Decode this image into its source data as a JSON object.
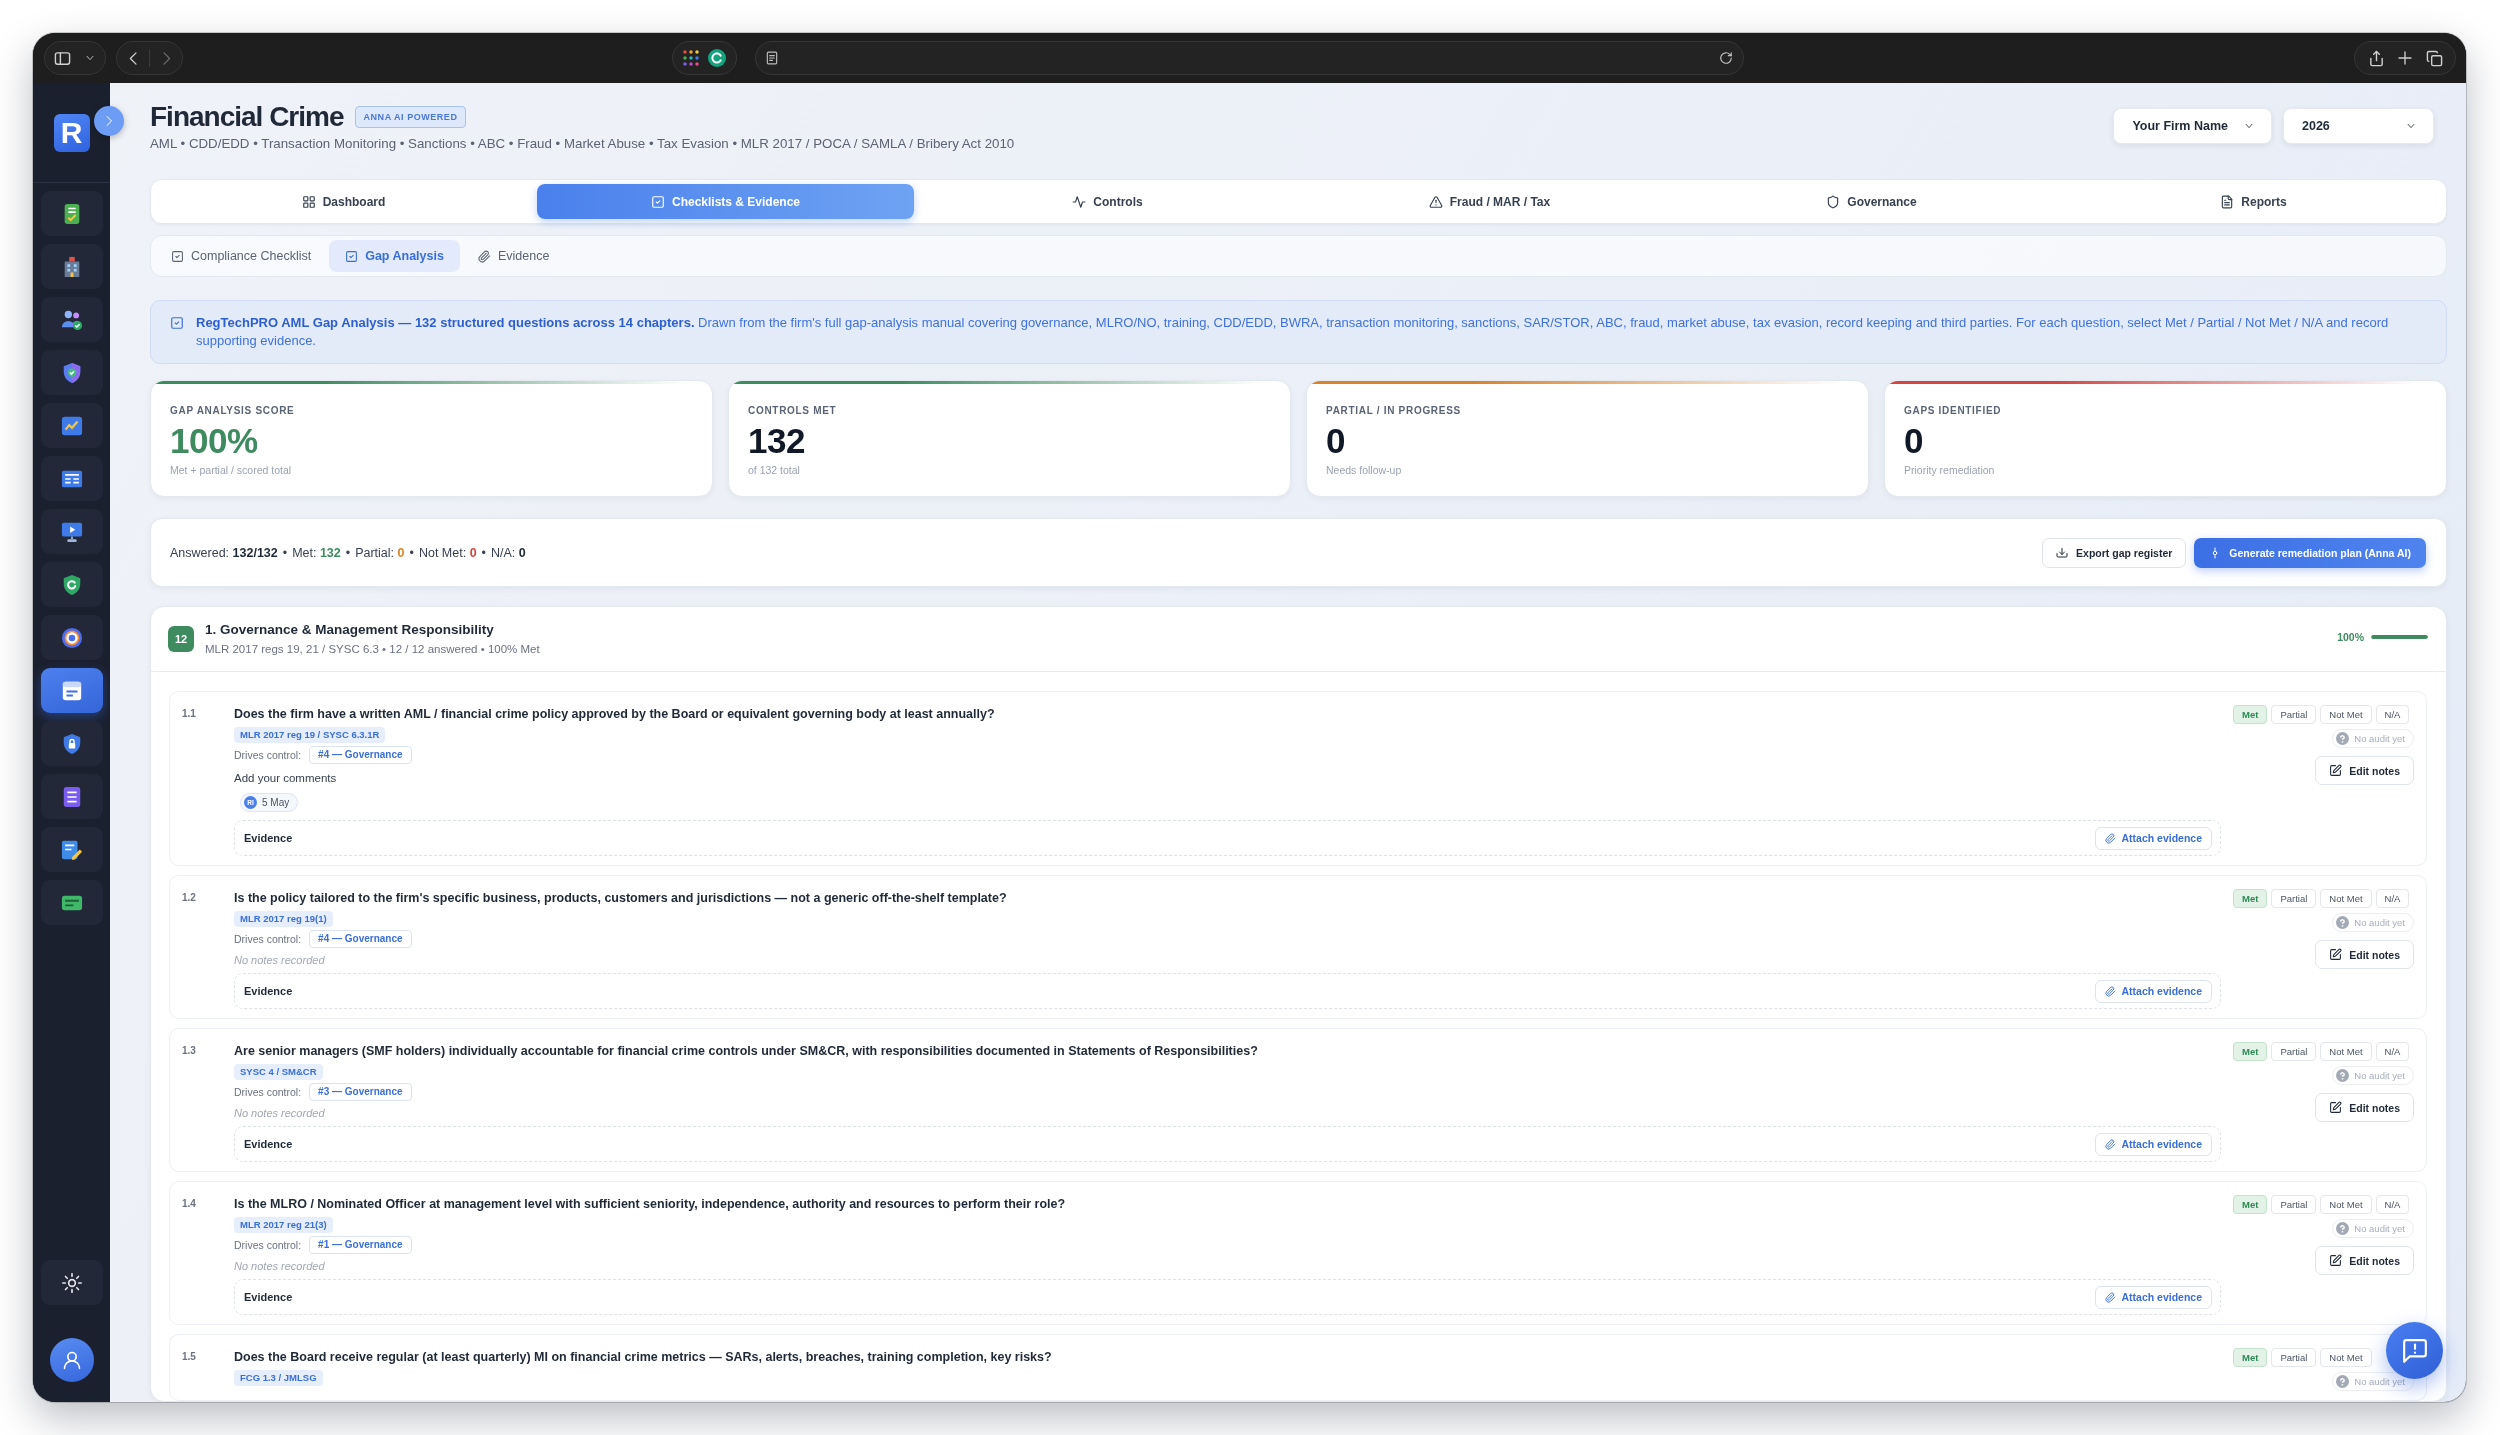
{
  "sidebar": {
    "logo": "R",
    "items": [
      {
        "selected": false
      },
      {
        "selected": false
      },
      {
        "selected": false
      },
      {
        "selected": false
      },
      {
        "selected": false
      },
      {
        "selected": false
      },
      {
        "selected": false
      },
      {
        "selected": false
      },
      {
        "selected": false
      },
      {
        "selected": true
      },
      {
        "selected": false
      },
      {
        "selected": false
      },
      {
        "selected": false
      },
      {
        "selected": false
      }
    ]
  },
  "header": {
    "title": "Financial Crime",
    "badge": "ANNA AI POWERED",
    "subtitle": "AML • CDD/EDD • Transaction Monitoring • Sanctions • ABC • Fraud • Market Abuse • Tax Evasion • MLR 2017 / POCA / SAMLA / Bribery Act 2010"
  },
  "selectors": [
    {
      "value": "Your Firm Name"
    },
    {
      "value": "2026"
    }
  ],
  "tabs": [
    {
      "label": "Dashboard",
      "selected": false
    },
    {
      "label": "Checklists & Evidence",
      "selected": true
    },
    {
      "label": "Controls",
      "selected": false
    },
    {
      "label": "Fraud / MAR / Tax",
      "selected": false
    },
    {
      "label": "Governance",
      "selected": false
    },
    {
      "label": "Reports",
      "selected": false
    }
  ],
  "subtabs": [
    {
      "label": "Compliance Checklist",
      "selected": false
    },
    {
      "label": "Gap Analysis",
      "selected": true
    },
    {
      "label": "Evidence",
      "selected": false
    }
  ],
  "banner": {
    "text": "**RegTechPRO AML Gap Analysis — 132 structured questions across 14 chapters.** Drawn from the firm's full gap-analysis manual covering governance, MLRO/NO, training, CDD/EDD, BWRA, transaction monitoring, sanctions, SAR/STOR, ABC, fraud, market abuse, tax evasion, record keeping and third parties. For each question, select Met / Partial / Not Met / N/A and record supporting evidence."
  },
  "stats": [
    {
      "label": "GAP ANALYSIS SCORE",
      "value": "100%",
      "note": "Met + partial / scored total",
      "color": "#3d8b5f",
      "emphasized": true
    },
    {
      "label": "CONTROLS MET",
      "value": "132",
      "note": "of 132 total",
      "color": "#3d8b5f",
      "emphasized": false
    },
    {
      "label": "PARTIAL / IN PROGRESS",
      "value": "0",
      "note": "Needs follow-up",
      "color": "#d9822b",
      "emphasized": false
    },
    {
      "label": "GAPS IDENTIFIED",
      "value": "0",
      "note": "Priority remediation",
      "color": "#d64541",
      "emphasized": false
    }
  ],
  "summary": {
    "items": [
      {
        "label": "Answered:",
        "value": "132/132",
        "color": "#1f2937"
      },
      {
        "separator": "•",
        "label": "Met:",
        "value": "132",
        "color": "#3d8b5f"
      },
      {
        "separator": "•",
        "label": "Partial:",
        "value": "0",
        "color": "#d9822b"
      },
      {
        "separator": "•",
        "label": "Not Met:",
        "value": "0",
        "color": "#d64541"
      },
      {
        "separator": "•",
        "label": "N/A:",
        "value": "0",
        "color": "#1f2937"
      }
    ]
  },
  "actions": [
    {
      "label": "Export gap register",
      "kind": "secondary"
    },
    {
      "label": "Generate remediation plan (Anna AI)",
      "kind": "primary"
    }
  ],
  "chapter": {
    "count": "12",
    "title": "1. Governance & Management Responsibility",
    "meta": "MLR 2017 regs 19, 21 / SYSC 6.3 • 12 / 12 answered • 100% Met",
    "percent": "100%",
    "level": 1,
    "questions": [
      {
        "number": "1.1",
        "text": "Does the firm have a written AML / financial crime policy approved by the Board or equivalent governing body at least annually?",
        "reference": "MLR 2017 reg 19 / SYSC 6.3.1R",
        "control": {
          "label": "Drives control:",
          "value": "#4 — Governance"
        },
        "comments": {
          "label": "Add your comments",
          "initials": "RI",
          "date": "5 May"
        },
        "evidence": {
          "label": "Evidence",
          "action": "Attach evidence"
        },
        "options": [
          {
            "label": "Met",
            "selected": true
          },
          {
            "label": "Partial",
            "selected": false
          },
          {
            "label": "Not Met",
            "selected": false
          },
          {
            "label": "N/A",
            "selected": false
          }
        ],
        "audit": "No audit yet",
        "edit": "Edit notes"
      },
      {
        "number": "1.2",
        "text": "Is the policy tailored to the firm's specific business, products, customers and jurisdictions — not a generic off-the-shelf template?",
        "reference": "MLR 2017 reg 19(1)",
        "control": {
          "label": "Drives control:",
          "value": "#4 — Governance"
        },
        "notes": "No notes recorded",
        "evidence": {
          "label": "Evidence",
          "action": "Attach evidence"
        },
        "options": [
          {
            "label": "Met",
            "selected": true
          },
          {
            "label": "Partial",
            "selected": false
          },
          {
            "label": "Not Met",
            "selected": false
          },
          {
            "label": "N/A",
            "selected": false
          }
        ],
        "audit": "No audit yet",
        "edit": "Edit notes"
      },
      {
        "number": "1.3",
        "text": "Are senior managers (SMF holders) individually accountable for financial crime controls under SM&CR, with responsibilities documented in Statements of Responsibilities?",
        "reference": "SYSC 4 / SM&CR",
        "control": {
          "label": "Drives control:",
          "value": "#3 — Governance"
        },
        "notes": "No notes recorded",
        "evidence": {
          "label": "Evidence",
          "action": "Attach evidence"
        },
        "options": [
          {
            "label": "Met",
            "selected": true
          },
          {
            "label": "Partial",
            "selected": false
          },
          {
            "label": "Not Met",
            "selected": false
          },
          {
            "label": "N/A",
            "selected": false
          }
        ],
        "audit": "No audit yet",
        "edit": "Edit notes"
      },
      {
        "number": "1.4",
        "text": "Is the MLRO / Nominated Officer at management level with sufficient seniority, independence, authority and resources to perform their role?",
        "reference": "MLR 2017 reg 21(3)",
        "control": {
          "label": "Drives control:",
          "value": "#1 — Governance"
        },
        "notes": "No notes recorded",
        "evidence": {
          "label": "Evidence",
          "action": "Attach evidence"
        },
        "options": [
          {
            "label": "Met",
            "selected": true
          },
          {
            "label": "Partial",
            "selected": false
          },
          {
            "label": "Not Met",
            "selected": false
          },
          {
            "label": "N/A",
            "selected": false
          }
        ],
        "audit": "No audit yet",
        "edit": "Edit notes"
      },
      {
        "number": "1.5",
        "text": "Does the Board receive regular (at least quarterly) MI on financial crime metrics — SARs, alerts, breaches, training completion, key risks?",
        "reference": "FCG 1.3 / JMLSG",
        "options": [
          {
            "label": "Met",
            "selected": true
          },
          {
            "label": "Partial",
            "selected": false
          },
          {
            "label": "Not Met",
            "selected": false
          }
        ],
        "audit": "No audit yet"
      }
    ]
  }
}
